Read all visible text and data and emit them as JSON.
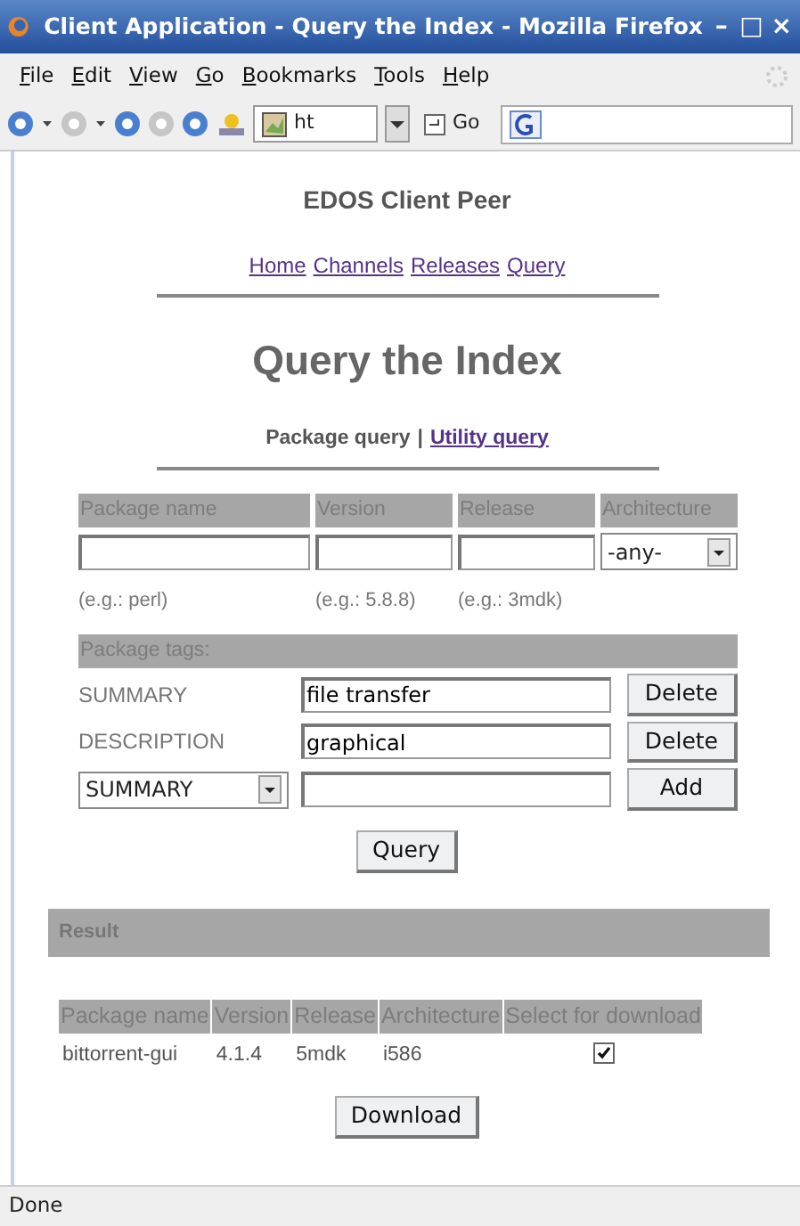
{
  "window": {
    "title": "Client Application - Query the Index - Mozilla Firefox",
    "controls": [
      "–",
      "□",
      "×"
    ]
  },
  "menu": [
    {
      "key": "F",
      "rest": "ile"
    },
    {
      "key": "E",
      "rest": "dit"
    },
    {
      "key": "V",
      "rest": "iew"
    },
    {
      "key": "G",
      "rest": "o"
    },
    {
      "key": "B",
      "rest": "ookmarks"
    },
    {
      "key": "T",
      "rest": "ools"
    },
    {
      "key": "H",
      "rest": "elp"
    }
  ],
  "toolbar": {
    "address": "ht",
    "go": "Go"
  },
  "page": {
    "site_title": "EDOS Client Peer",
    "nav": [
      {
        "label": "Home"
      },
      {
        "label": "Channels"
      },
      {
        "label": "Releases"
      },
      {
        "label": "Query"
      }
    ],
    "heading": "Query the Index",
    "query_tabs": [
      {
        "label": "Package query",
        "selected": true
      },
      {
        "label": "Utility query",
        "selected": false
      }
    ],
    "tab_separator": "|",
    "package_fields": [
      {
        "label": "Package name",
        "kind": "text",
        "hint": "(e.g.: perl)"
      },
      {
        "label": "Version",
        "kind": "text",
        "hint": "(e.g.: 5.8.8)"
      },
      {
        "label": "Release",
        "kind": "text",
        "hint": "(e.g.: 3mdk)"
      },
      {
        "label": "Architecture",
        "kind": "select",
        "value": "-any-"
      }
    ],
    "tags": {
      "header": "Package tags:",
      "rows": [
        {
          "kind": "fixed",
          "name": "SUMMARY",
          "value": "file transfer",
          "button": "Delete"
        },
        {
          "kind": "fixed",
          "name": "DESCRIPTION",
          "value": "graphical",
          "button": "Delete"
        },
        {
          "kind": "new",
          "name": "SUMMARY",
          "button": "Add"
        }
      ]
    },
    "query_button": "Query",
    "result": {
      "title": "Result",
      "columns": [
        "Package name",
        "Version",
        "Release",
        "Architecture",
        "Select for download"
      ],
      "rows": [
        {
          "cells": [
            "bittorrent-gui",
            "4.1.4",
            "5mdk",
            "i586"
          ],
          "selected": true
        }
      ]
    },
    "download_button": "Download"
  },
  "status_bar": "Done"
}
